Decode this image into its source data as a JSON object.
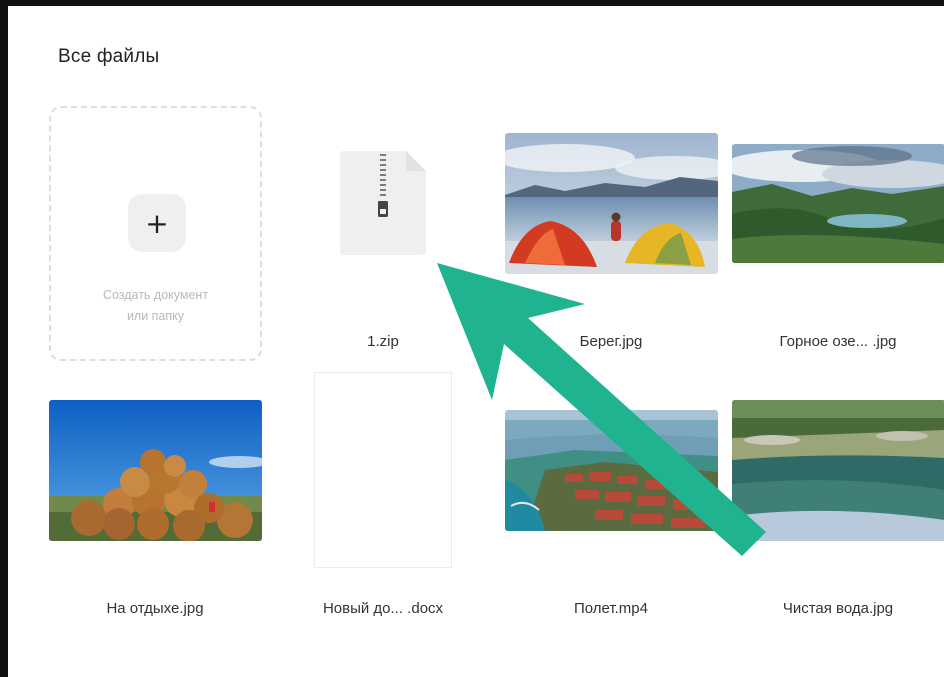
{
  "header": {
    "title": "Все файлы"
  },
  "create": {
    "plus": "+",
    "text": "Создать документ\nили папку"
  },
  "files": [
    {
      "name": "1.zip",
      "kind": "zip-icon"
    },
    {
      "name": "Берег.jpg",
      "kind": "photo"
    },
    {
      "name": "Горное озе... .jpg",
      "kind": "photo"
    },
    {
      "name": "На отдыхе.jpg",
      "kind": "photo"
    },
    {
      "name": "Новый до... .docx",
      "kind": "document"
    },
    {
      "name": "Полет.mp4",
      "kind": "video"
    },
    {
      "name": "Чистая вода.jpg",
      "kind": "photo"
    }
  ],
  "colors": {
    "accent_arrow": "#1fb38f",
    "create_text": "#b9b9b9",
    "tile_background": "#efefef"
  }
}
